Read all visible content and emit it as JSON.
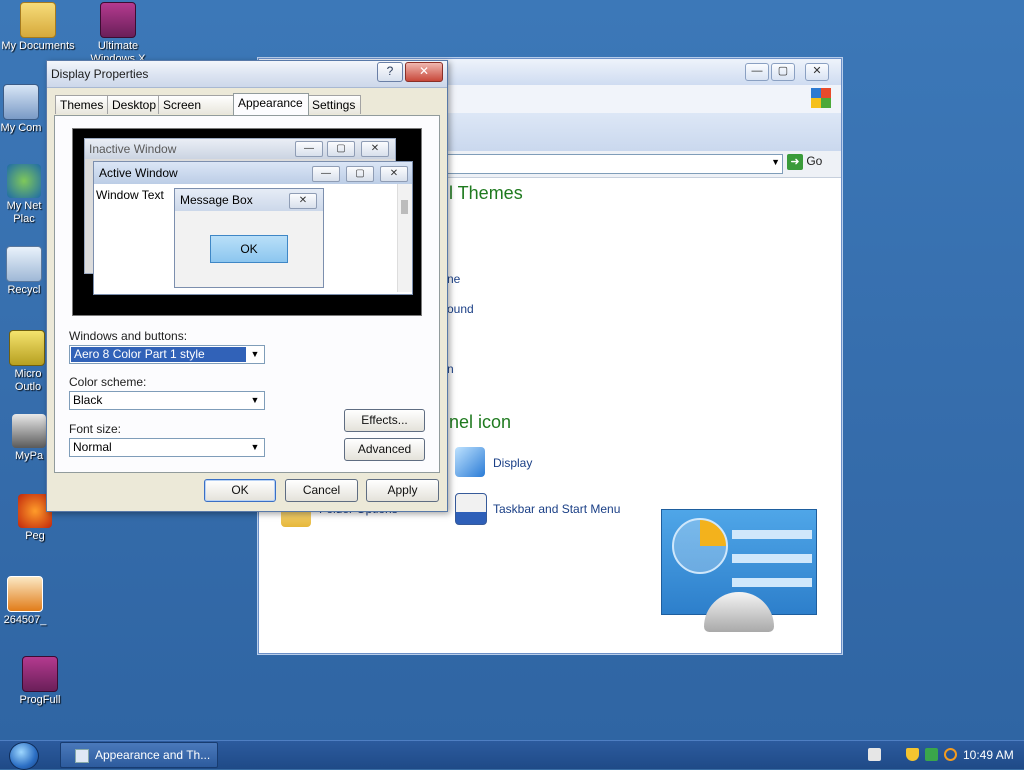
{
  "desktop_icons": [
    {
      "label": "My Documents",
      "kind": "folder"
    },
    {
      "label": "Ultimate Windows X",
      "kind": "rar"
    },
    {
      "label": "My Com",
      "kind": "computer"
    },
    {
      "label": "My Net Plac",
      "kind": "network"
    },
    {
      "label": "Recycl",
      "kind": "recycle"
    },
    {
      "label": "Micro Outlo",
      "kind": "outlook"
    },
    {
      "label": "MyPa",
      "kind": "mypaint"
    },
    {
      "label": "Peg",
      "kind": "peg"
    },
    {
      "label": "264507_",
      "kind": "photo"
    },
    {
      "label": "ProgFull",
      "kind": "rar"
    }
  ],
  "background_window": {
    "go_label": "Go",
    "heading_themes": "l Themes",
    "link_1": "ne",
    "link_2": "ound",
    "link_3": "n",
    "heading_icon": "nel icon",
    "display_label": "Display",
    "taskbar_label": "Taskbar and Start Menu",
    "folder_options_label": "Folder Options"
  },
  "dialog": {
    "title": "Display Properties",
    "help_btn": "?",
    "close_btn": "✕",
    "tabs": [
      "Themes",
      "Desktop",
      "Screen Saver",
      "Appearance",
      "Settings"
    ],
    "active_tab": "Appearance",
    "preview": {
      "inactive_title": "Inactive Window",
      "active_title": "Active Window",
      "window_text": "Window Text",
      "message_title": "Message Box",
      "ok_label": "OK"
    },
    "windows_buttons_label": "Windows and buttons:",
    "windows_buttons_value": "Aero 8 Color Part 1 style",
    "color_scheme_label": "Color scheme:",
    "color_scheme_value": "Black",
    "font_size_label": "Font size:",
    "font_size_value": "Normal",
    "effects_btn": "Effects...",
    "advanced_btn": "Advanced",
    "ok_btn": "OK",
    "cancel_btn": "Cancel",
    "apply_btn": "Apply"
  },
  "taskbar": {
    "task_label": "Appearance and Th...",
    "clock": "10:49 AM"
  },
  "colors": {
    "desktop": "#3a6ea5",
    "dialog_bg": "#ece9d8",
    "cp_heading": "#1f7a1f",
    "link": "#1a3f86"
  }
}
